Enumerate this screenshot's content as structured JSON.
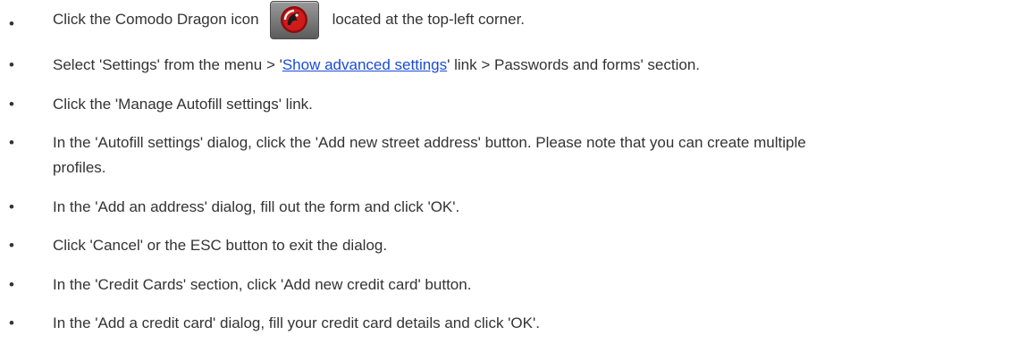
{
  "bullet": "•",
  "steps": [
    {
      "before": "Click the Comodo Dragon icon",
      "icon": "comodo-dragon-icon",
      "after": "located at the top-left corner."
    },
    {
      "before": "Select 'Settings' from the menu > '",
      "link": "Show advanced settings",
      "after": "' link > Passwords and forms' section."
    },
    {
      "text": "Click the 'Manage Autofill settings' link."
    },
    {
      "line1": "In the 'Autofill settings' dialog, click the 'Add new street address' button. Please note that you can create multiple",
      "line2": "profiles."
    },
    {
      "text": "In the 'Add an address' dialog, fill out the form and click 'OK'."
    },
    {
      "text": "Click 'Cancel' or the ESC button to exit the dialog."
    },
    {
      "text": "In the 'Credit Cards' section, click 'Add new credit card' button."
    },
    {
      "text": "In the 'Add a credit card' dialog, fill your credit card details and click 'OK'."
    }
  ],
  "colors": {
    "text": "#333333",
    "link": "#1a4bd6",
    "icon_red": "#d11a1a"
  }
}
